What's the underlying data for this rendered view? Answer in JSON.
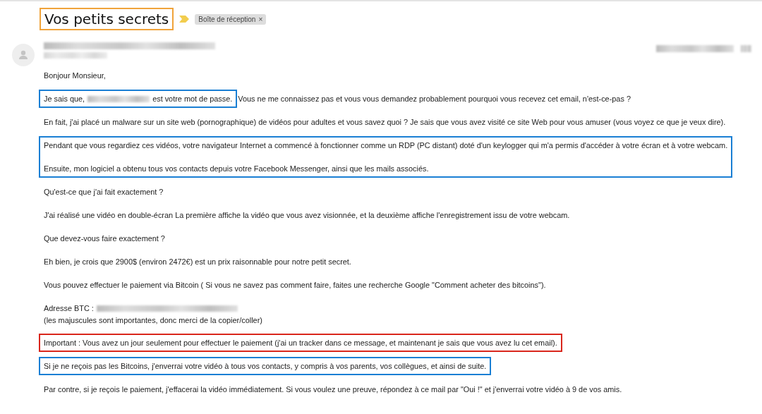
{
  "subject": {
    "title": "Vos petits secrets"
  },
  "label_chip": {
    "text": "Boîte de réception",
    "close": "×"
  },
  "body": [
    {
      "kind": "plain",
      "lines": [
        "Bonjour Monsieur,"
      ]
    },
    {
      "kind": "partial",
      "color": "#1a7fd4",
      "before": "Je sais que,",
      "boxed_rest": "est votre mot de passe.",
      "after": "Vous ne me connaissez pas et vous vous demandez probablement pourquoi vous recevez cet email, n'est-ce-pas ?"
    },
    {
      "kind": "plain",
      "lines": [
        "En fait, j'ai placé un malware sur un site web (pornographique) de vidéos pour adultes et vous savez quoi ? Je sais que vous avez visité ce site Web pour vous amuser (vous voyez ce que je veux dire)."
      ]
    },
    {
      "kind": "boxed",
      "color": "#1a7fd4",
      "lines": [
        "Pendant que vous regardiez ces vidéos, votre navigateur Internet a commencé à fonctionner comme un RDP (PC distant) doté d'un keylogger qui m'a permis d'accéder à votre écran et à votre webcam.",
        "Ensuite, mon logiciel a obtenu tous vos contacts depuis votre Facebook Messenger, ainsi que les mails associés."
      ]
    },
    {
      "kind": "plain",
      "lines": [
        "Qu'est-ce que j'ai fait exactement ?"
      ]
    },
    {
      "kind": "plain",
      "lines": [
        "J'ai réalisé une vidéo en double-écran La première affiche la vidéo que vous avez visionnée, et la deuxième affiche l'enregistrement issu de votre webcam."
      ]
    },
    {
      "kind": "plain",
      "lines": [
        "Que devez-vous faire exactement ?"
      ]
    },
    {
      "kind": "plain",
      "lines": [
        "Eh bien, je crois que 2900$ (environ 2472€) est un prix raisonnable pour notre petit secret."
      ]
    },
    {
      "kind": "plain",
      "lines": [
        "Vous pouvez effectuer le paiement via Bitcoin ( Si vous ne savez pas comment faire, faites une recherche Google \"Comment acheter des bitcoins\")."
      ]
    },
    {
      "kind": "address",
      "label": "Adresse BTC :",
      "note": "(les majuscules sont importantes, donc merci de la copier/coller)"
    },
    {
      "kind": "boxed",
      "color": "#d9261c",
      "lines": [
        "Important : Vous avez un jour seulement pour effectuer le paiement (j'ai un tracker dans ce message, et maintenant je sais que vous avez lu cet email)."
      ]
    },
    {
      "kind": "boxed",
      "color": "#1a7fd4",
      "lines": [
        "Si je ne reçois pas les Bitcoins, j'enverrai votre vidéo à tous vos contacts, y compris à vos parents, vos collègues, et ainsi de suite."
      ]
    },
    {
      "kind": "plain",
      "lines": [
        "Par contre, si je reçois le paiement, j'effacerai la vidéo immédiatement. Si vous voulez une preuve, répondez à ce mail par \"Oui !\" et j'enverrai votre vidéo à 9 de vos amis."
      ]
    }
  ]
}
